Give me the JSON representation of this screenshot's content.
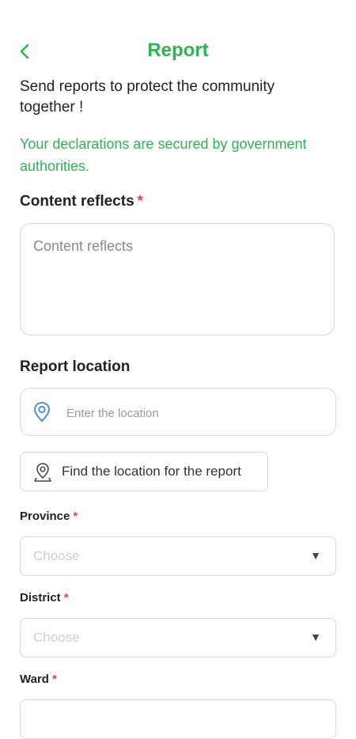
{
  "header": {
    "title": "Report",
    "back_icon": "chevron-left-icon"
  },
  "intro_text": " Send reports to protect the community together !",
  "secure_text": "Your declarations are secured by government authorities.",
  "content_section": {
    "label": "Content reflects",
    "required_mark": "*",
    "placeholder": "Content reflects"
  },
  "location_section": {
    "label": "Report location",
    "input_placeholder": "Enter the location",
    "input_icon": "location-pin-icon",
    "find_button_label": "Find the location for the report",
    "find_button_icon": "map-pin-outline-icon"
  },
  "province": {
    "label": "Province",
    "required_mark": "*",
    "value": "Choose",
    "arrow": "▼"
  },
  "district": {
    "label": "District",
    "required_mark": "*",
    "value": "Choose",
    "arrow": "▼"
  },
  "ward": {
    "label": "Ward",
    "required_mark": "*"
  },
  "colors": {
    "accent": "#2eb355",
    "required": "#e84040",
    "icon_blue": "#4a8fe7",
    "border": "#d8d8d8"
  }
}
